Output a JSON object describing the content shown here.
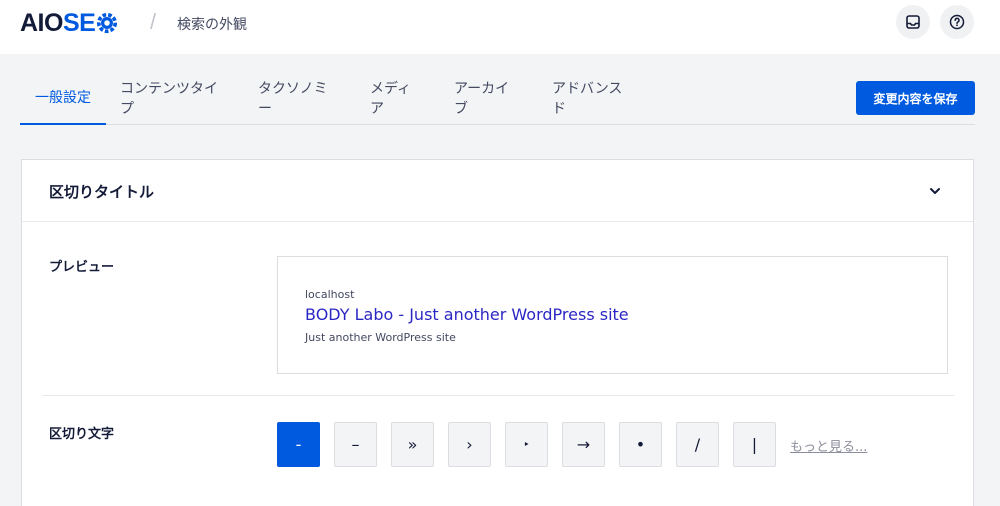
{
  "logo": {
    "part1": "AIO",
    "part2": "SE"
  },
  "header": {
    "separator": "/",
    "title": "検索の外観"
  },
  "tabs": [
    {
      "label": "一般設定",
      "active": true
    },
    {
      "label": "コンテンツタイプ",
      "active": false
    },
    {
      "label": "タクソノミー",
      "active": false
    },
    {
      "label": "メディア",
      "active": false
    },
    {
      "label": "アーカイブ",
      "active": false
    },
    {
      "label": "アドバンスド",
      "active": false
    }
  ],
  "save_button": "変更内容を保存",
  "card": {
    "title": "区切りタイトル",
    "preview": {
      "label": "プレビュー",
      "url": "localhost",
      "title": "BODY Labo - Just another WordPress site",
      "description": "Just another WordPress site"
    },
    "separator": {
      "label": "区切り文字",
      "options": [
        "-",
        "–",
        "»",
        "›",
        "‣",
        "→",
        "•",
        "/",
        "|"
      ],
      "selected_index": 0,
      "more_link": "もっと見る..."
    }
  },
  "icons": {
    "inbox": "inbox-icon",
    "help": "help-icon",
    "chevron": "chevron-down-icon",
    "gear": "gear-icon"
  },
  "colors": {
    "accent": "#005ae0",
    "link": "#2b27c4",
    "text": "#141b38"
  }
}
